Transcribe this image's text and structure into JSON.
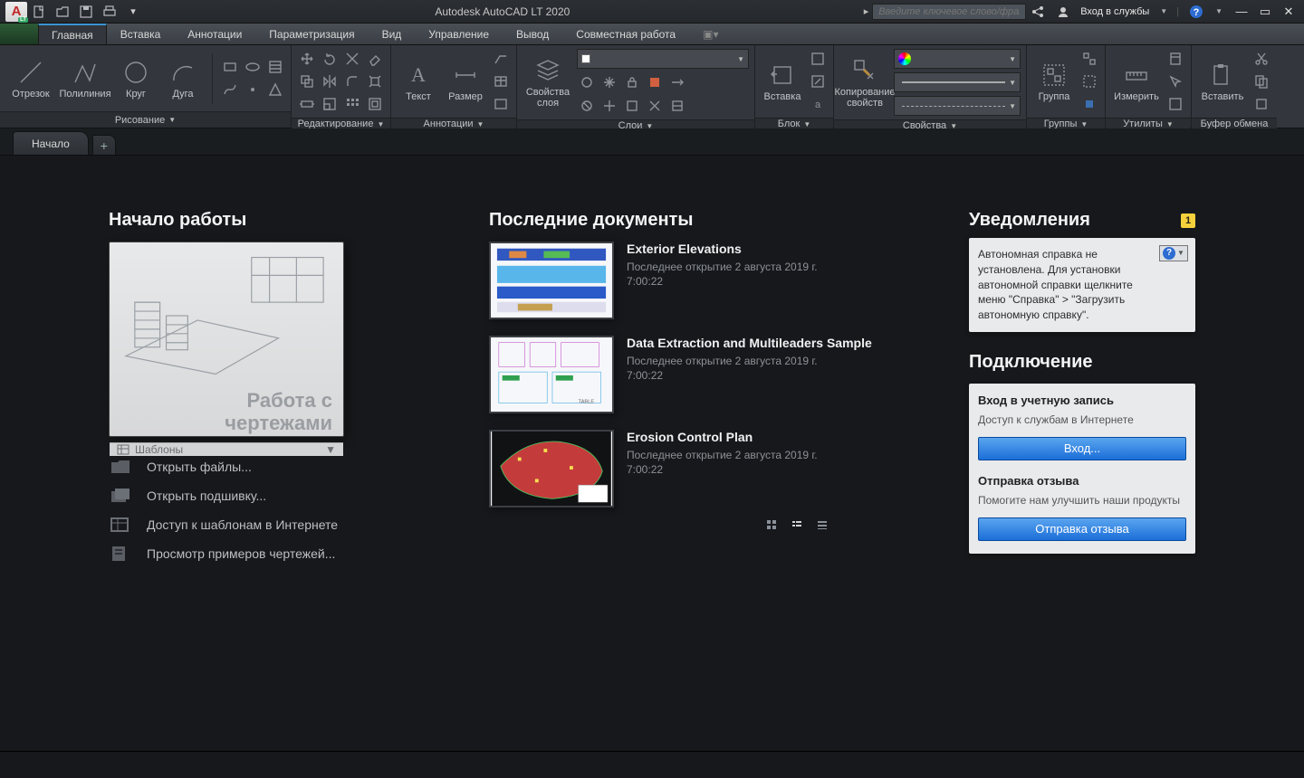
{
  "app": {
    "title": "Autodesk AutoCAD LT 2020"
  },
  "search": {
    "placeholder": "Введите ключевое слово/фразу"
  },
  "user": {
    "signin": "Вход в службы"
  },
  "ribbon": {
    "tabs": {
      "home": "Главная",
      "insert": "Вставка",
      "annotate": "Аннотации",
      "parametric": "Параметризация",
      "view": "Вид",
      "manage": "Управление",
      "output": "Вывод",
      "collaborate": "Совместная работа"
    },
    "panels": {
      "draw": {
        "label": "Рисование",
        "line": "Отрезок",
        "polyline": "Полилиния",
        "circle": "Круг",
        "arc": "Дуга"
      },
      "modify": {
        "label": "Редактирование"
      },
      "annotation": {
        "label": "Аннотации",
        "text": "Текст",
        "dimension": "Размер"
      },
      "layers": {
        "label": "Слои",
        "layerprops": "Свойства\nслоя"
      },
      "block": {
        "label": "Блок",
        "insert": "Вставка"
      },
      "properties": {
        "label": "Свойства",
        "match": "Копирование\nсвойств"
      },
      "groups": {
        "label": "Группы",
        "group": "Группа"
      },
      "utilities": {
        "label": "Утилиты",
        "measure": "Измерить"
      },
      "clipboard": {
        "label": "Буфер обмена",
        "paste": "Вставить"
      }
    }
  },
  "filetabs": {
    "start": "Начало"
  },
  "start": {
    "getting_started": "Начало работы",
    "card_title": "Работа с\nчертежами",
    "templates": "Шаблоны",
    "open_files": "Открыть файлы...",
    "open_sheetset": "Открыть подшивку...",
    "online_templates": "Доступ к шаблонам в Интернете",
    "sample_drawings": "Просмотр примеров чертежей..."
  },
  "recent": {
    "title": "Последние документы",
    "items": [
      {
        "name": "Exterior Elevations",
        "opened": "Последнее открытие 2 августа 2019 г.",
        "time": "7:00:22"
      },
      {
        "name": "Data Extraction and Multileaders Sample",
        "opened": "Последнее открытие 2 августа 2019 г.",
        "time": "7:00:22"
      },
      {
        "name": "Erosion Control Plan",
        "opened": "Последнее открытие 2 августа 2019 г.",
        "time": "7:00:22"
      }
    ]
  },
  "notifications": {
    "title": "Уведомления",
    "count": "1",
    "body": "Автономная справка не установлена. Для установки автономной справки щелкните меню \"Справка\" > \"Загрузить автономную справку\"."
  },
  "connect": {
    "title": "Подключение",
    "signin_h": "Вход в учетную запись",
    "signin_t": "Доступ к службам в Интернете",
    "signin_btn": "Вход...",
    "feedback_h": "Отправка отзыва",
    "feedback_t": "Помогите нам улучшить наши продукты",
    "feedback_btn": "Отправка отзыва"
  }
}
